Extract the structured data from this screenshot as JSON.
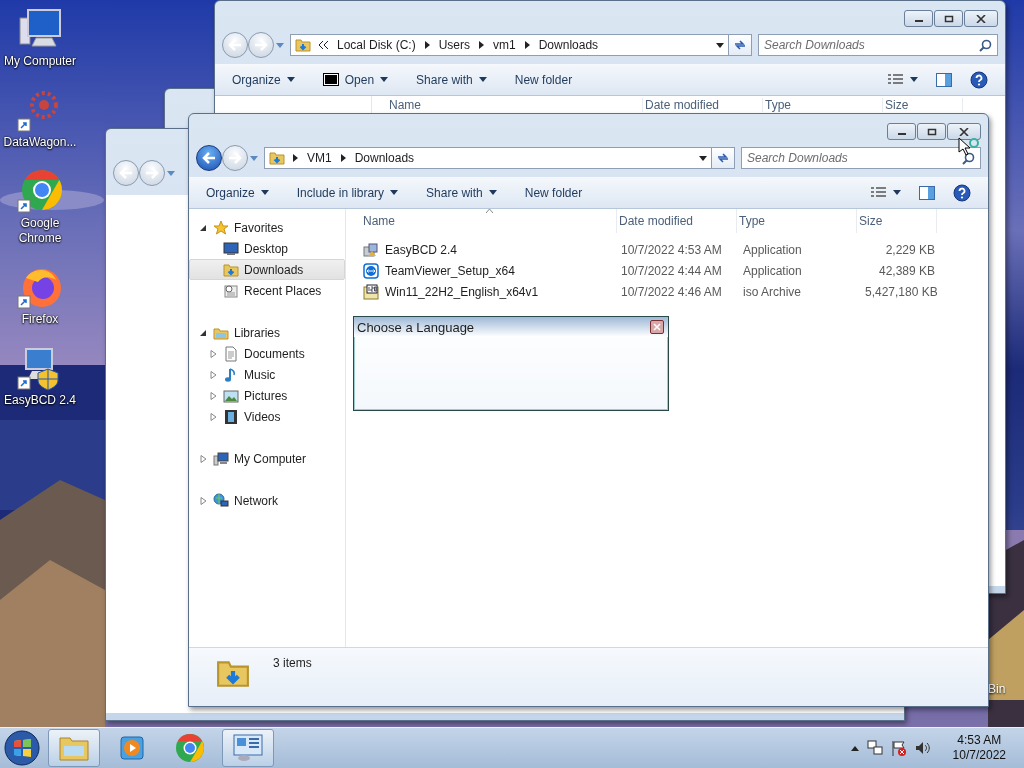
{
  "desktop": {
    "icons": [
      {
        "label": "My Computer",
        "kind": "computer"
      },
      {
        "label": "DataWagon...",
        "kind": "datawagon"
      },
      {
        "label": "Google Chrome",
        "kind": "chrome"
      },
      {
        "label": "Firefox",
        "kind": "firefox"
      },
      {
        "label": "EasyBCD 2.4",
        "kind": "easybcd"
      }
    ],
    "recycle_label": "Bin"
  },
  "back_window": {
    "address": [
      "Local Disk (C:)",
      "Users",
      "vm1",
      "Downloads"
    ],
    "search": {
      "placeholder": "Search Downloads"
    },
    "toolbar": [
      {
        "label": "Organize",
        "kind": "menu"
      },
      {
        "label": "Open",
        "kind": "open"
      },
      {
        "label": "Share with",
        "kind": "menu"
      },
      {
        "label": "New folder",
        "kind": "plain"
      }
    ],
    "columns": [
      "Name",
      "Date modified",
      "Type",
      "Size"
    ]
  },
  "front_window": {
    "address": [
      "VM1",
      "Downloads"
    ],
    "search": {
      "placeholder": "Search Downloads"
    },
    "toolbar": [
      {
        "label": "Organize",
        "kind": "menu"
      },
      {
        "label": "Include in library",
        "kind": "menu"
      },
      {
        "label": "Share with",
        "kind": "menu"
      },
      {
        "label": "New folder",
        "kind": "plain"
      }
    ],
    "nav": [
      {
        "label": "Favorites",
        "kind": "star",
        "selected": false,
        "expanded": true,
        "children": [
          {
            "label": "Desktop",
            "kind": "desktop",
            "selected": false
          },
          {
            "label": "Downloads",
            "kind": "downloads",
            "selected": true
          },
          {
            "label": "Recent Places",
            "kind": "recent",
            "selected": false
          }
        ]
      },
      {
        "label": "Libraries",
        "kind": "library",
        "selected": false,
        "expanded": true,
        "children": [
          {
            "label": "Documents",
            "kind": "documents",
            "selected": false,
            "expanded": false
          },
          {
            "label": "Music",
            "kind": "music",
            "selected": false,
            "expanded": false
          },
          {
            "label": "Pictures",
            "kind": "pictures",
            "selected": false,
            "expanded": false
          },
          {
            "label": "Videos",
            "kind": "videos",
            "selected": false,
            "expanded": false
          }
        ]
      },
      {
        "label": "My Computer",
        "kind": "computer",
        "selected": false,
        "expanded": false
      },
      {
        "label": "Network",
        "kind": "network",
        "selected": false,
        "expanded": false
      }
    ],
    "columns": [
      "Name",
      "Date modified",
      "Type",
      "Size"
    ],
    "files": [
      {
        "name": "EasyBCD 2.4",
        "kind": "installer",
        "date": "10/7/2022 4:53 AM",
        "type": "Application",
        "size": "2,229 KB"
      },
      {
        "name": "TeamViewer_Setup_x64",
        "kind": "remote",
        "date": "10/7/2022 4:44 AM",
        "type": "Application",
        "size": "42,389 KB"
      },
      {
        "name": "Win11_22H2_English_x64v1",
        "kind": "iso",
        "date": "10/7/2022 4:46 AM",
        "type": "iso Archive",
        "size": "5,427,180 KB"
      }
    ],
    "status": "3 items"
  },
  "dialog": {
    "title": "Choose a Language"
  },
  "taskbar": {
    "items": [
      {
        "kind": "explorer",
        "selected": true
      },
      {
        "kind": "media",
        "selected": false
      },
      {
        "kind": "chrome",
        "selected": false
      },
      {
        "kind": "panel",
        "selected": true
      }
    ],
    "time": "4:53 AM",
    "date": "10/7/2022"
  }
}
